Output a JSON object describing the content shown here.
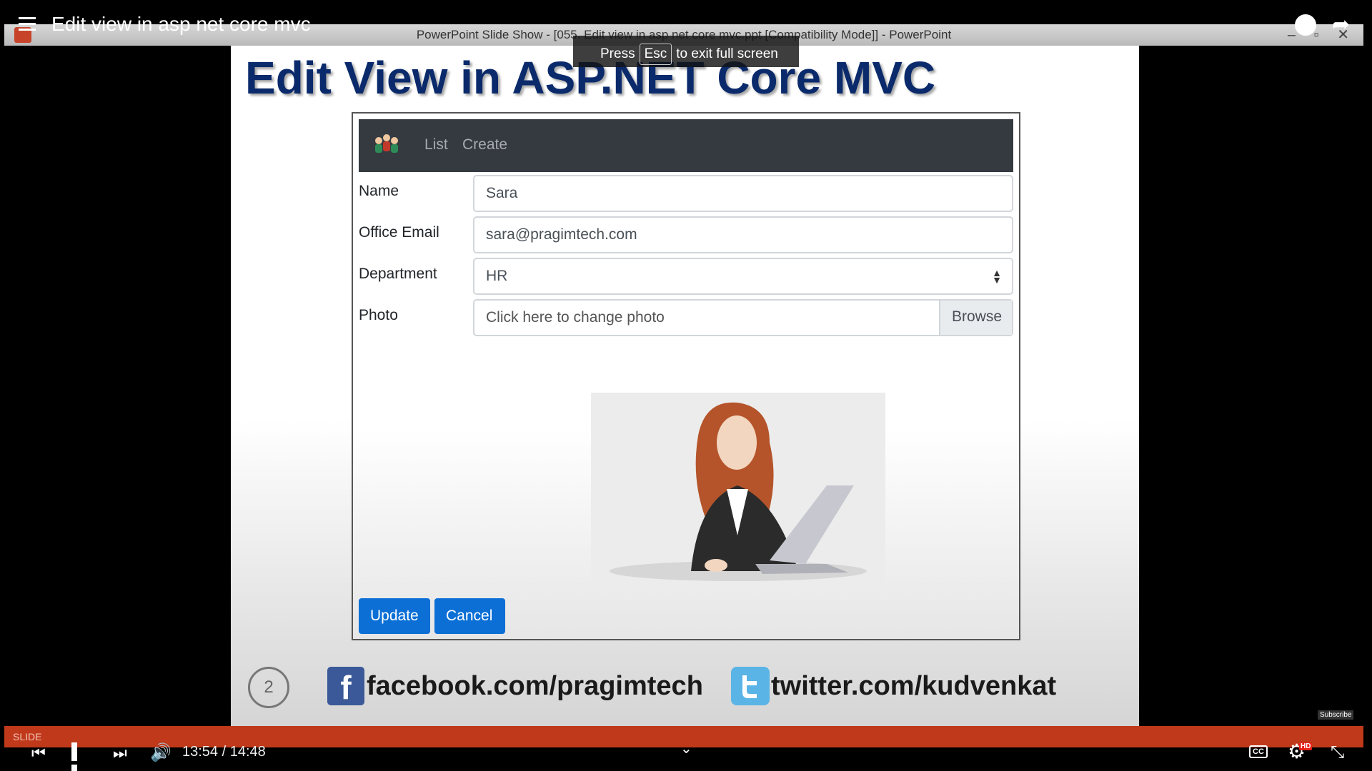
{
  "video": {
    "title": "Edit view in asp net core mvc",
    "time": "13:54 / 14:48",
    "hd_badge": "HD",
    "cc_label": "CC",
    "subscribe_label": "Subscribe"
  },
  "powerpoint": {
    "window_title": "PowerPoint Slide Show - [055. Edit view in asp net core mvc.ppt [Compatibility Mode]] - PowerPoint",
    "status_label": "SLIDE",
    "esc_prefix": "Press",
    "esc_key": "Esc",
    "esc_suffix": "to exit full screen"
  },
  "slide": {
    "title": "Edit View in ASP.NET Core MVC",
    "number": "2",
    "facebook": "facebook.com/pragimtech",
    "twitter": "twitter.com/kudvenkat"
  },
  "app": {
    "nav": {
      "list": "List",
      "create": "Create"
    },
    "form": {
      "name_label": "Name",
      "name_value": "Sara",
      "email_label": "Office Email",
      "email_value": "sara@pragimtech.com",
      "department_label": "Department",
      "department_value": "HR",
      "photo_label": "Photo",
      "photo_placeholder": "Click here to change photo",
      "browse_label": "Browse",
      "update_label": "Update",
      "cancel_label": "Cancel"
    }
  },
  "colors": {
    "navbar": "#343a40",
    "primary_button": "#0b6fd6",
    "slide_title": "#0a2a6b",
    "progress_bar": "#c0391b"
  }
}
